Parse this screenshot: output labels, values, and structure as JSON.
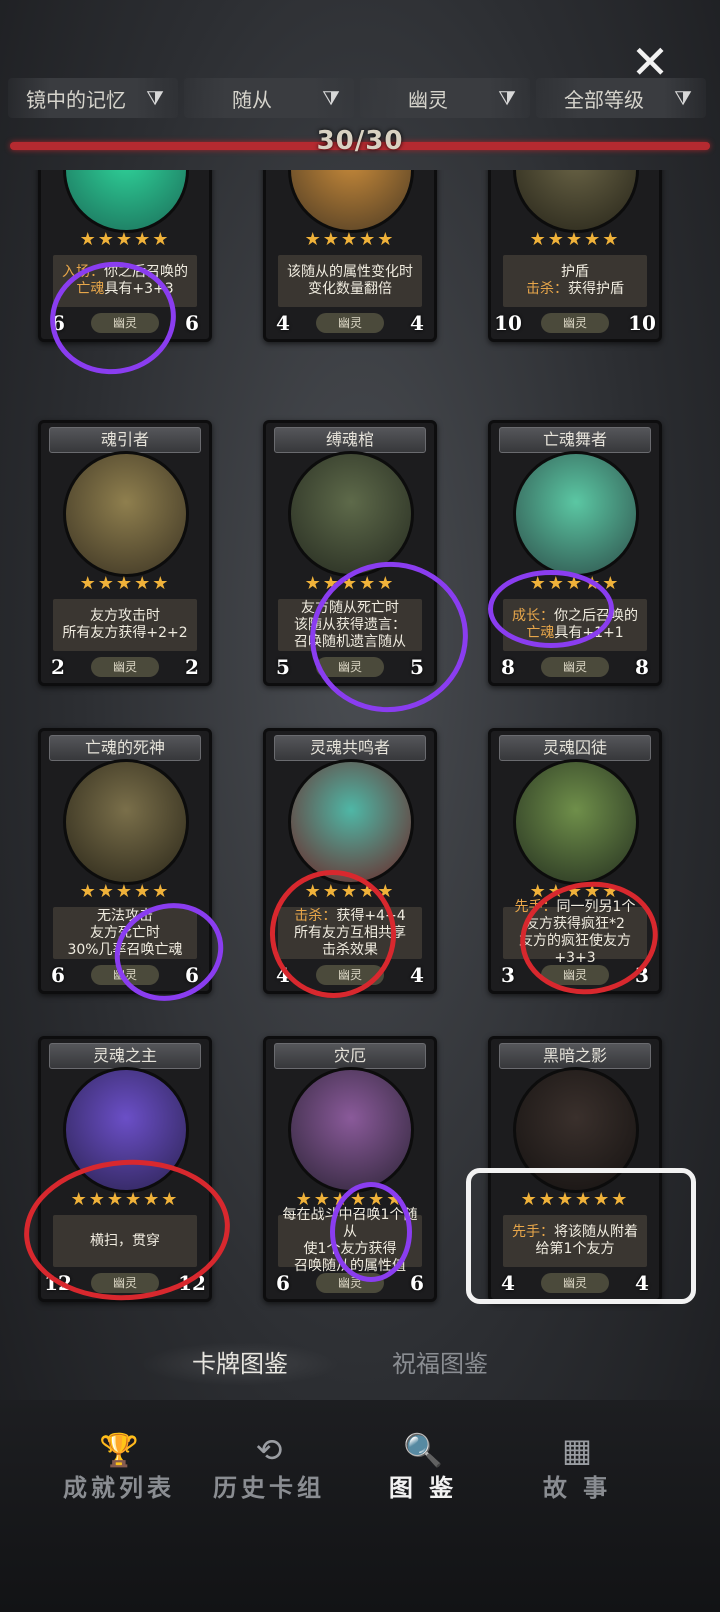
{
  "header": {
    "close_icon": "close-icon",
    "filters": [
      {
        "label": "镜中的记忆",
        "icon": "filter-icon"
      },
      {
        "label": "随从",
        "icon": "filter-icon"
      },
      {
        "label": "幽灵",
        "icon": "filter-icon"
      },
      {
        "label": "全部等级",
        "icon": "filter-icon"
      }
    ],
    "collected": 30,
    "total": 30,
    "count_text": "30/30"
  },
  "cards": [
    {
      "name": "",
      "stars": "★★★★★",
      "lines": [
        [
          "入场：",
          "你之后召唤的"
        ],
        [
          "亡魂",
          "具有+3+3"
        ]
      ],
      "atk": "6",
      "hp": "6",
      "tribe": "幽灵",
      "art": [
        "#2fd49a",
        "#1b6b58"
      ]
    },
    {
      "name": "",
      "stars": "★★★★★",
      "lines": [
        [
          "",
          "该随从的属性变化时"
        ],
        [
          "",
          "变化数量翻倍"
        ]
      ],
      "atk": "4",
      "hp": "4",
      "tribe": "幽灵",
      "art": [
        "#c98b3a",
        "#4b3a24"
      ]
    },
    {
      "name": "",
      "stars": "★★★★★",
      "lines": [
        [
          "",
          "护盾"
        ],
        [
          "击杀：",
          "获得护盾"
        ]
      ],
      "atk": "10",
      "hp": "10",
      "tribe": "幽灵",
      "art": [
        "#6a6446",
        "#262419"
      ]
    },
    {
      "name": "魂引者",
      "stars": "★★★★★",
      "lines": [
        [
          "",
          "友方攻击时"
        ],
        [
          "",
          "所有友方获得+2+2"
        ]
      ],
      "atk": "2",
      "hp": "2",
      "tribe": "幽灵",
      "art": [
        "#8f7f4e",
        "#3b3323"
      ]
    },
    {
      "name": "缚魂棺",
      "stars": "★★★★★",
      "lines": [
        [
          "",
          "友方随从死亡时"
        ],
        [
          "",
          "该随从获得遗言："
        ],
        [
          "",
          "召唤随机遗言随从"
        ]
      ],
      "atk": "5",
      "hp": "5",
      "tribe": "幽灵",
      "art": [
        "#5e6a4a",
        "#252a20"
      ]
    },
    {
      "name": "亡魂舞者",
      "stars": "★★★★★",
      "lines": [
        [
          "成长：",
          "你之后召唤的"
        ],
        [
          "亡魂",
          "具有+1+1"
        ]
      ],
      "atk": "8",
      "hp": "8",
      "tribe": "幽灵",
      "art": [
        "#5bc7a3",
        "#2d4d49"
      ]
    },
    {
      "name": "亡魂的死神",
      "stars": "★★★★★",
      "lines": [
        [
          "",
          "无法攻击"
        ],
        [
          "",
          "友方死亡时"
        ],
        [
          "",
          "30%几率召唤亡魂"
        ]
      ],
      "atk": "6",
      "hp": "6",
      "tribe": "幽灵",
      "art": [
        "#7a6f4a",
        "#2a2619"
      ]
    },
    {
      "name": "灵魂共鸣者",
      "stars": "★★★★★",
      "lines": [
        [
          "击杀：",
          "获得+4+4"
        ],
        [
          "",
          "所有友方互相共享"
        ],
        [
          "",
          "击杀效果"
        ]
      ],
      "atk": "4",
      "hp": "4",
      "tribe": "幽灵",
      "art": [
        "#4fb7a6",
        "#6b2424"
      ]
    },
    {
      "name": "灵魂囚徒",
      "stars": "★★★★★",
      "lines": [
        [
          "先手：",
          "同一列另1个"
        ],
        [
          "",
          "友方获得疯狂*2"
        ],
        [
          "",
          "友方的疯狂使友方+3+3"
        ]
      ],
      "atk": "3",
      "hp": "3",
      "tribe": "幽灵",
      "art": [
        "#6f8f4a",
        "#253020"
      ]
    },
    {
      "name": "灵魂之主",
      "stars": "★★★★★★",
      "lines": [
        [
          "",
          "横扫，贯穿"
        ]
      ],
      "atk": "12",
      "hp": "12",
      "tribe": "幽灵",
      "art": [
        "#6b4fc7",
        "#2a2250"
      ]
    },
    {
      "name": "灾厄",
      "stars": "★★★★★★",
      "lines": [
        [
          "",
          "每在战斗中召唤1个随从"
        ],
        [
          "",
          "使1个友方获得"
        ],
        [
          "",
          "召唤随从的属性值"
        ]
      ],
      "atk": "6",
      "hp": "6",
      "tribe": "幽灵",
      "art": [
        "#8a5a9a",
        "#2c2436"
      ]
    },
    {
      "name": "黑暗之影",
      "stars": "★★★★★★",
      "lines": [
        [
          "先手：",
          "将该随从附着"
        ],
        [
          "",
          "给第1个友方"
        ]
      ],
      "atk": "4",
      "hp": "4",
      "tribe": "幽灵",
      "art": [
        "#3a302c",
        "#151211"
      ]
    }
  ],
  "sub_tabs": [
    {
      "label": "卡牌图鉴",
      "active": true
    },
    {
      "label": "祝福图鉴",
      "active": false
    }
  ],
  "bottom_nav": [
    {
      "label": "成就列表",
      "icon": "trophy-icon",
      "glyph": "🏆",
      "active": false
    },
    {
      "label": "历史卡组",
      "icon": "history-icon",
      "glyph": "⟲",
      "active": false
    },
    {
      "label": "图 鉴",
      "icon": "magnifier-icon",
      "glyph": "🔍",
      "active": true
    },
    {
      "label": "故 事",
      "icon": "book-icon",
      "glyph": "▦",
      "active": false
    }
  ],
  "colors": {
    "keyword": "#e7a64a",
    "star": "#f0b23a",
    "progress": "#b52a30",
    "annotation_purple": "#8a3df0",
    "annotation_red": "#d8282e",
    "annotation_white": "#f2f2f2"
  }
}
